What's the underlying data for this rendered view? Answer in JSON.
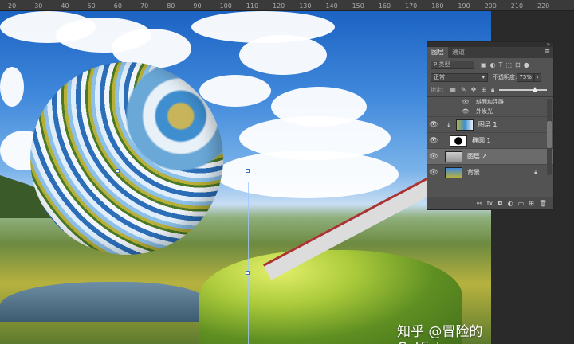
{
  "ruler": {
    "marks": [
      "20",
      "30",
      "40",
      "50",
      "60",
      "70",
      "80",
      "90",
      "100",
      "110",
      "120",
      "130",
      "140",
      "150",
      "160",
      "170",
      "180",
      "190",
      "200",
      "210",
      "220"
    ]
  },
  "panel": {
    "tabs": [
      "图层",
      "通道"
    ],
    "filter_kind": "P 类型",
    "blend_mode": "正常",
    "opacity_label": "不透明度:",
    "opacity_value": "75%",
    "lock_label": "锁定:",
    "effects": [
      "斜面和浮雕",
      "外发光"
    ],
    "layers": [
      {
        "name": "图层 1",
        "selected": false
      },
      {
        "name": "椭圆 1",
        "selected": false
      },
      {
        "name": "图层 2",
        "selected": true
      },
      {
        "name": "背景",
        "selected": false
      }
    ],
    "opacity_fraction": 0.75
  },
  "watermark": "知乎 @冒险的Cutfish",
  "colors": {
    "accent": "#3b76c4",
    "panel_bg": "#535353",
    "selected_row": "#6b6b6b"
  }
}
